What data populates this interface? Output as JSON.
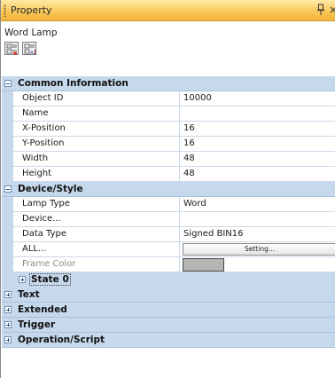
{
  "title": "Property",
  "object_name": "Word Lamp",
  "toolbar": [
    {
      "name": "categorized-view-button",
      "icon": "categorized-icon"
    },
    {
      "name": "alphabetical-view-button",
      "icon": "alphabetical-icon"
    }
  ],
  "window_controls": {
    "pin_icon": "pin-icon",
    "close_icon": "close-icon"
  },
  "categories": [
    {
      "label": "Common Information",
      "expanded": true,
      "rows": [
        {
          "name": "Object ID",
          "value": "10000"
        },
        {
          "name": "Name",
          "value": ""
        },
        {
          "name": "X-Position",
          "value": "16"
        },
        {
          "name": "Y-Position",
          "value": "16"
        },
        {
          "name": "Width",
          "value": "48"
        },
        {
          "name": "Height",
          "value": "48"
        }
      ]
    },
    {
      "label": "Device/Style",
      "expanded": true,
      "rows": [
        {
          "name": "Lamp Type",
          "value": "Word"
        },
        {
          "name": "Device...",
          "value": ""
        },
        {
          "name": "Data Type",
          "value": "Signed BIN16"
        },
        {
          "name": "ALL...",
          "value": "",
          "button": "Setting..."
        },
        {
          "name": "Frame Color",
          "value": "",
          "color": "#b5b5b5",
          "disabled": true
        }
      ],
      "sub": {
        "label": "State 0",
        "expanded": false
      }
    },
    {
      "label": "Text",
      "expanded": false
    },
    {
      "label": "Extended",
      "expanded": false
    },
    {
      "label": "Trigger",
      "expanded": false
    },
    {
      "label": "Operation/Script",
      "expanded": false
    }
  ],
  "colors": {
    "title_bar": "#f9c95a",
    "category_bg": "#c6d8ec",
    "grid_line": "#c9d9ea"
  }
}
